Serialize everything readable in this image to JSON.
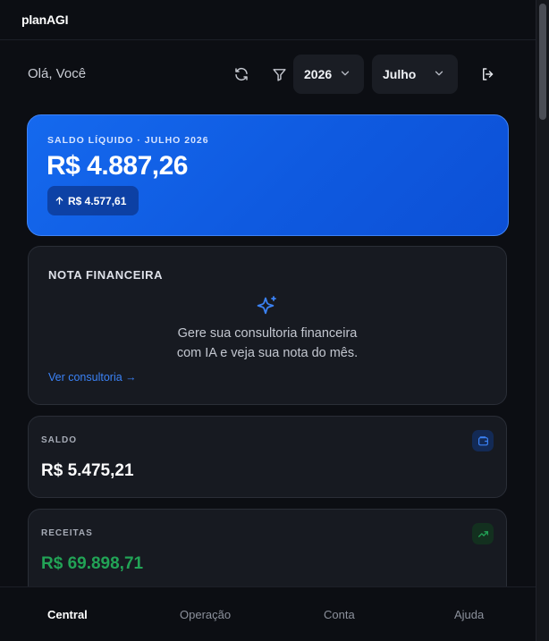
{
  "app": {
    "title": "planAGI"
  },
  "header": {
    "greeting": "Olá, Você",
    "refresh_icon": "refresh-icon",
    "filter_icon": "filter-icon",
    "year_select": {
      "value": "2026"
    },
    "month_select": {
      "value": "Julho"
    },
    "logout_icon": "logout-icon"
  },
  "hero": {
    "label": "SALDO LÍQUIDO · JULHO 2026",
    "value": "R$ 4.887,26",
    "delta": "R$ 4.577,61",
    "delta_icon": "arrow-up-icon"
  },
  "nota": {
    "title": "NOTA FINANCEIRA",
    "icon": "sparkle-icon",
    "line1": "Gere sua consultoria financeira",
    "line2": "com IA e veja sua nota do mês.",
    "link": "Ver consultoria →"
  },
  "metrics": {
    "saldo": {
      "label": "SALDO",
      "value": "R$ 5.475,21",
      "icon": "wallet-icon"
    },
    "receitas": {
      "label": "RECEITAS",
      "value": "R$ 69.898,71",
      "icon": "trending-up-icon"
    }
  },
  "nav": {
    "items": [
      "Central",
      "Operação",
      "Conta",
      "Ajuda"
    ],
    "active": "Central"
  },
  "colors": {
    "accent": "#1569ee",
    "background": "#0c0e13",
    "card": "#171a21",
    "positive": "#22a356",
    "link": "#3b82f6"
  }
}
